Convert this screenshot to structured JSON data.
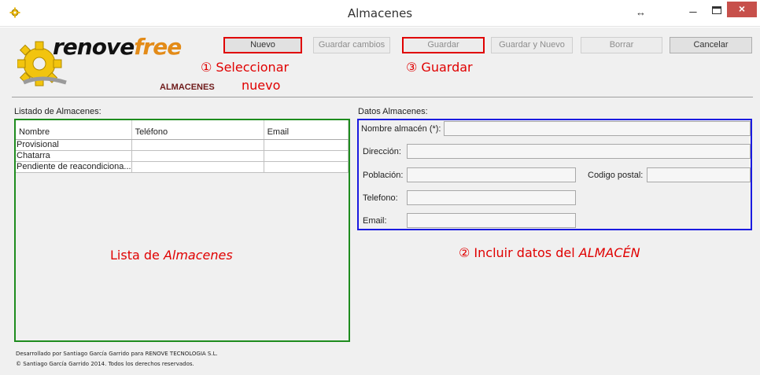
{
  "window": {
    "title": "Almacenes",
    "resize_symbol": "↔",
    "minimize_symbol": "_",
    "close_symbol": "×"
  },
  "logo": {
    "part1": "renove",
    "part2": "free",
    "colors": {
      "gear": "#f2c40e",
      "text": "#111111",
      "accent": "#e38b18"
    }
  },
  "section_title": "ALMACENES",
  "toolbar": {
    "nuevo": "Nuevo",
    "guardar_cambios": "Guardar cambios",
    "guardar": "Guardar",
    "guardar_y_nuevo": "Guardar y Nuevo",
    "borrar": "Borrar",
    "cancelar": "Cancelar"
  },
  "annotations": {
    "step1_line1": "① Seleccionar",
    "step1_line2": "nuevo",
    "step3": "③ Guardar",
    "step2_prefix": "② Incluir datos del ",
    "step2_emph": "ALMACÉN",
    "list_prefix": "Lista de ",
    "list_emph": "Almacenes",
    "colors": {
      "annotation": "#e00000",
      "list_box": "#1e8c1e",
      "form_box": "#1a1ae0"
    }
  },
  "list": {
    "label": "Listado de Almacenes:",
    "columns": [
      "Nombre",
      "Teléfono",
      "Email"
    ],
    "rows": [
      [
        "Provisional",
        "",
        ""
      ],
      [
        "Chatarra",
        "",
        ""
      ],
      [
        "Pendiente de reacondiciona...",
        "",
        ""
      ]
    ]
  },
  "form": {
    "label": "Datos Almacenes:",
    "nombre_label": "Nombre almacén (*):",
    "nombre_value": "",
    "direccion_label": "Dirección:",
    "direccion_value": "",
    "poblacion_label": "Población:",
    "poblacion_value": "",
    "codigo_postal_label": "Codigo postal:",
    "codigo_postal_value": "",
    "telefono_label": "Telefono:",
    "telefono_value": "",
    "email_label": "Email:",
    "email_value": ""
  },
  "footer": {
    "line1": "Desarrollado por Santiago García Garrido para RENOVE TECNOLOGIA S.L.",
    "line2": "© Santiago García Garrido 2014. Todos los derechos reservados."
  }
}
